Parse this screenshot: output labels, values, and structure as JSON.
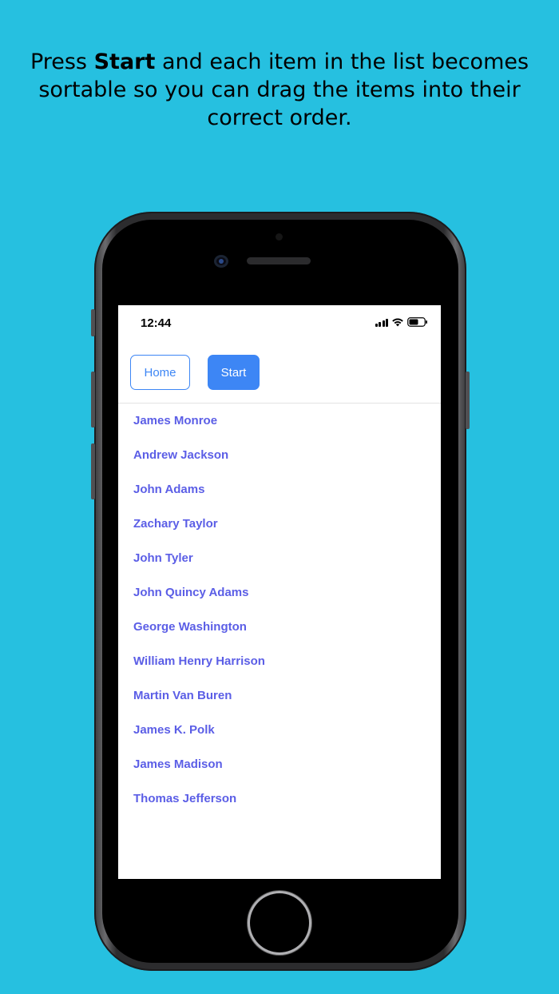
{
  "headline": {
    "part1": "Press ",
    "bold": "Start",
    "part2": " and each item in the list becomes sortable so you can drag the items into their correct order."
  },
  "status": {
    "time": "12:44"
  },
  "toolbar": {
    "home_label": "Home",
    "start_label": "Start"
  },
  "items": [
    "James Monroe",
    "Andrew Jackson",
    "John Adams",
    "Zachary Taylor",
    "John Tyler",
    "John Quincy Adams",
    "George Washington",
    "William Henry Harrison",
    "Martin Van Buren",
    "James K. Polk",
    "James Madison",
    "Thomas Jefferson"
  ],
  "colors": {
    "background": "#26c0e0",
    "accent": "#3d86f5",
    "list_text": "#5b5ee6"
  }
}
